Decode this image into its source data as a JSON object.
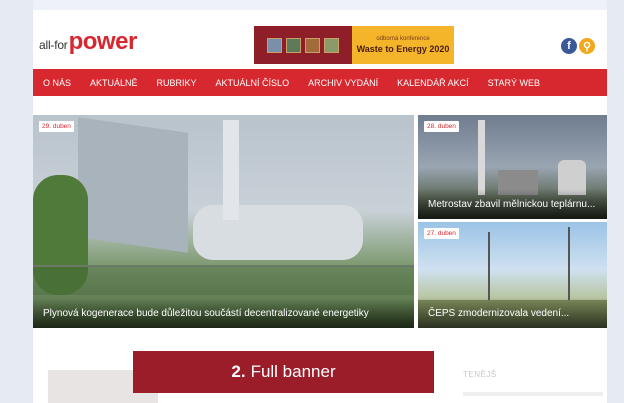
{
  "logo": {
    "small": "all-for",
    "big": "power"
  },
  "header_banner": {
    "subtitle": "odborná konference",
    "title": "Waste to Energy 2020"
  },
  "social": {
    "facebook": "f",
    "search": "⚲"
  },
  "nav": [
    "O NÁS",
    "AKTUÁLNĚ",
    "RUBRIKY",
    "AKTUÁLNÍ ČÍSLO",
    "ARCHIV VYDÁNÍ",
    "KALENDÁŘ AKCÍ",
    "STARÝ WEB"
  ],
  "main_article": {
    "date": "29. duben",
    "title": "Plynová kogenerace bude důležitou součástí decentralizované energetiky"
  },
  "side_articles": [
    {
      "date": "28. duben",
      "title": "Metrostav zbavil mělnickou teplárnu..."
    },
    {
      "date": "27. duben",
      "title": "ČEPS zmodernizovala vedení..."
    }
  ],
  "bottom": {
    "partial_heading": "TENĚJŠ"
  },
  "full_banner": {
    "number": "2.",
    "label": "Full banner"
  }
}
